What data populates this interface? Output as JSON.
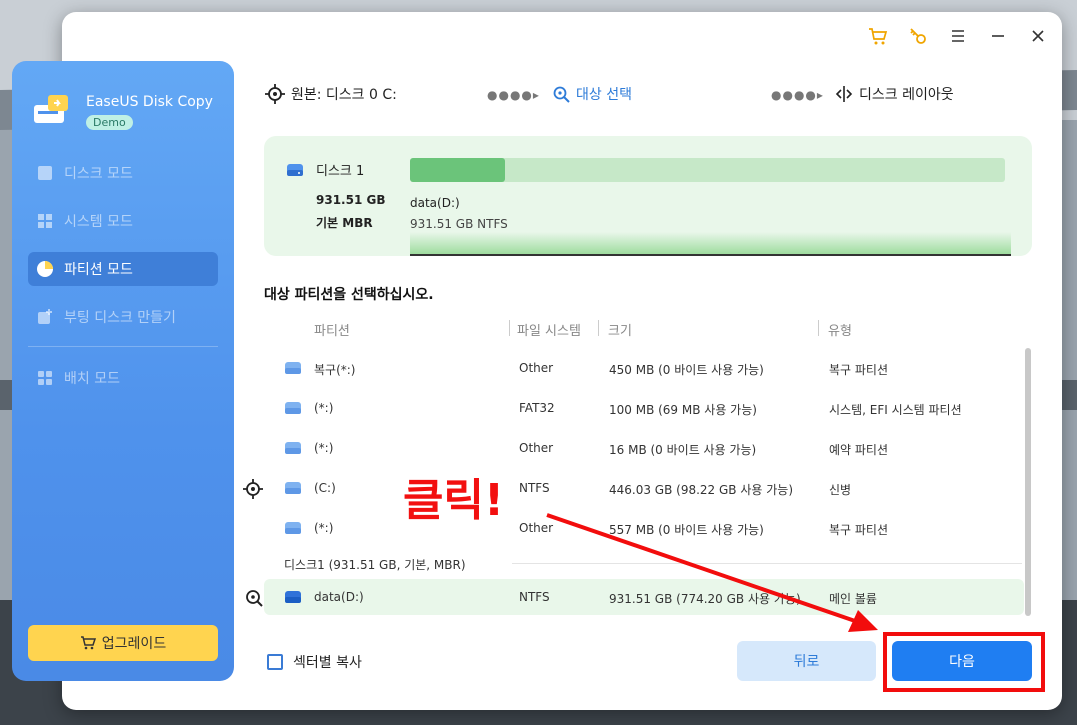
{
  "sidebar": {
    "brand_name": "EaseUS Disk Copy",
    "badge": "Demo",
    "items": [
      {
        "label": "디스크 모드",
        "icon": "disk-mode-icon",
        "active": false
      },
      {
        "label": "시스템 모드",
        "icon": "windows-icon",
        "active": false
      },
      {
        "label": "파티션 모드",
        "icon": "pie-chart-icon",
        "active": true
      },
      {
        "label": "부팅 디스크 만들기",
        "icon": "boot-disk-icon",
        "active": false
      },
      {
        "label": "배치 모드",
        "icon": "grid-icon",
        "active": false
      }
    ],
    "upgrade_label": "업그레이드"
  },
  "titlebar": {
    "icons": [
      "cart-icon",
      "key-icon",
      "menu-icon",
      "minimize-icon",
      "close-icon"
    ]
  },
  "steps": {
    "source": "원본: 디스크 0 C:",
    "target": "대상 선택",
    "layout": "디스크 레이아웃"
  },
  "disk": {
    "name": "디스크 1",
    "size": "931.51 GB",
    "type": "기본 MBR",
    "usage_fraction": 0.16,
    "partition_label": "data(D:)",
    "partition_sub": "931.51 GB NTFS"
  },
  "section_title": "대상 파티션을 선택하십시오.",
  "table": {
    "headers": [
      "파티션",
      "파일 시스템",
      "크기",
      "유형"
    ],
    "rows": [
      {
        "name": "복구(*:)",
        "fs": "Other",
        "size": "450 MB (0 바이트 사용 가능)",
        "type": "복구 파티션"
      },
      {
        "name": "(*:)",
        "fs": "FAT32",
        "size": "100 MB (69 MB 사용 가능)",
        "type": "시스템, EFI 시스템 파티션"
      },
      {
        "name": "(*:)",
        "fs": "Other",
        "size": "16 MB (0 바이트 사용 가능)",
        "type": "예약 파티션"
      },
      {
        "name": "(C:)",
        "fs": "NTFS",
        "size": "446.03 GB (98.22 GB 사용 가능)",
        "type": "신병"
      },
      {
        "name": "(*:)",
        "fs": "Other",
        "size": "557 MB (0 바이트 사용 가능)",
        "type": "복구 파티션"
      }
    ],
    "group_label": "디스크1 (931.51 GB, 기본, MBR)",
    "selected_row": {
      "name": "data(D:)",
      "fs": "NTFS",
      "size": "931.51 GB (774.20 GB 사용 가능)",
      "type": "메인 볼륨"
    }
  },
  "footer": {
    "sector_copy_label": "섹터별 복사",
    "back_label": "뒤로",
    "next_label": "다음"
  },
  "annotation": {
    "text": "클릭!",
    "color": "#f20d0d"
  },
  "colors": {
    "accent": "#1f7ef2",
    "sidebar": "#4f92ec",
    "disk_fill": "#6bc47a",
    "upgrade": "#ffd44f"
  }
}
